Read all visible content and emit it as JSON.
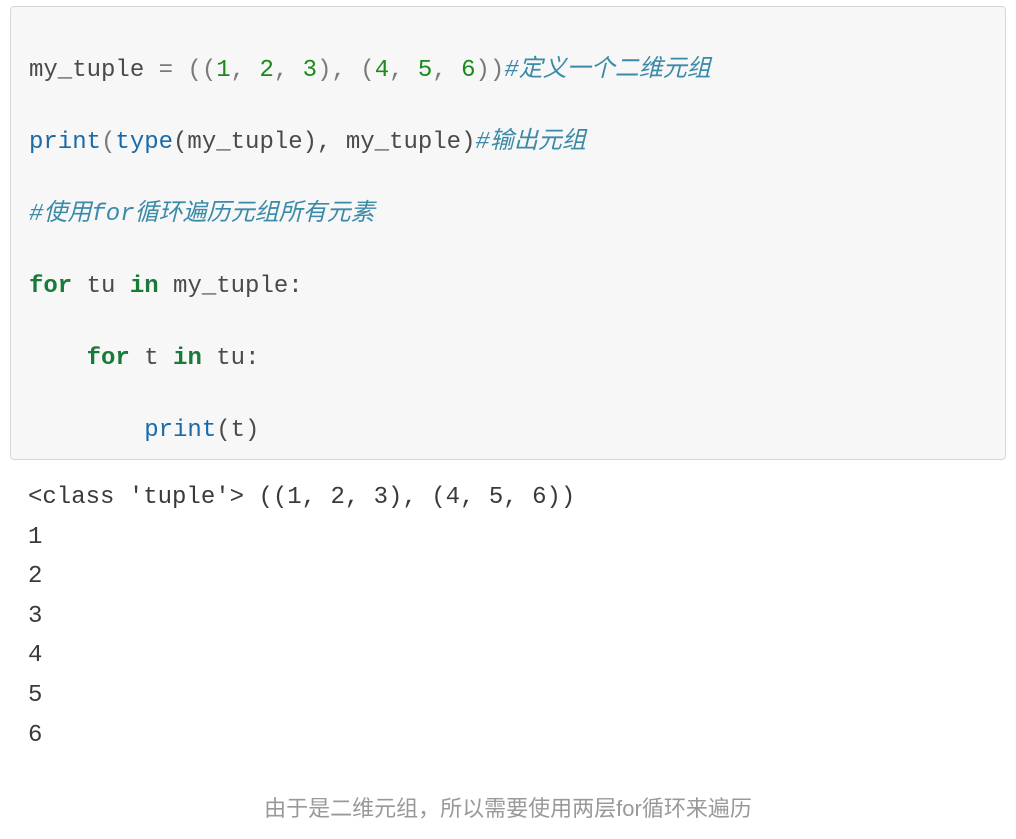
{
  "code": {
    "l1_var": "my_tuple",
    "l1_assign": " = ((",
    "l1_n1": "1",
    "l1_c1": ", ",
    "l1_n2": "2",
    "l1_c2": ", ",
    "l1_n3": "3",
    "l1_m1": "), (",
    "l1_n4": "4",
    "l1_c3": ", ",
    "l1_n5": "5",
    "l1_c4": ", ",
    "l1_n6": "6",
    "l1_cl": "))",
    "l1_comment": "#定义一个二维元组",
    "l2_print": "print",
    "l2_p1": "(",
    "l2_type": "type",
    "l2_p2": "(my_tuple), my_tuple)",
    "l2_comment": "#输出元组",
    "l3_comment": "#使用for循环遍历元组所有元素",
    "l4_for": "for",
    "l4_mid": " tu ",
    "l4_in": "in",
    "l4_end": " my_tuple:",
    "l5_indent": "    ",
    "l5_for": "for",
    "l5_mid": " t ",
    "l5_in": "in",
    "l5_end": " tu:",
    "l6_indent": "        ",
    "l6_print": "print",
    "l6_args": "(t)"
  },
  "output": {
    "line1": "<class 'tuple'> ((1, 2, 3), (4, 5, 6))",
    "line2": "1",
    "line3": "2",
    "line4": "3",
    "line5": "4",
    "line6": "5",
    "line7": "6"
  },
  "caption": "由于是二维元组，所以需要使用两层for循环来遍历"
}
